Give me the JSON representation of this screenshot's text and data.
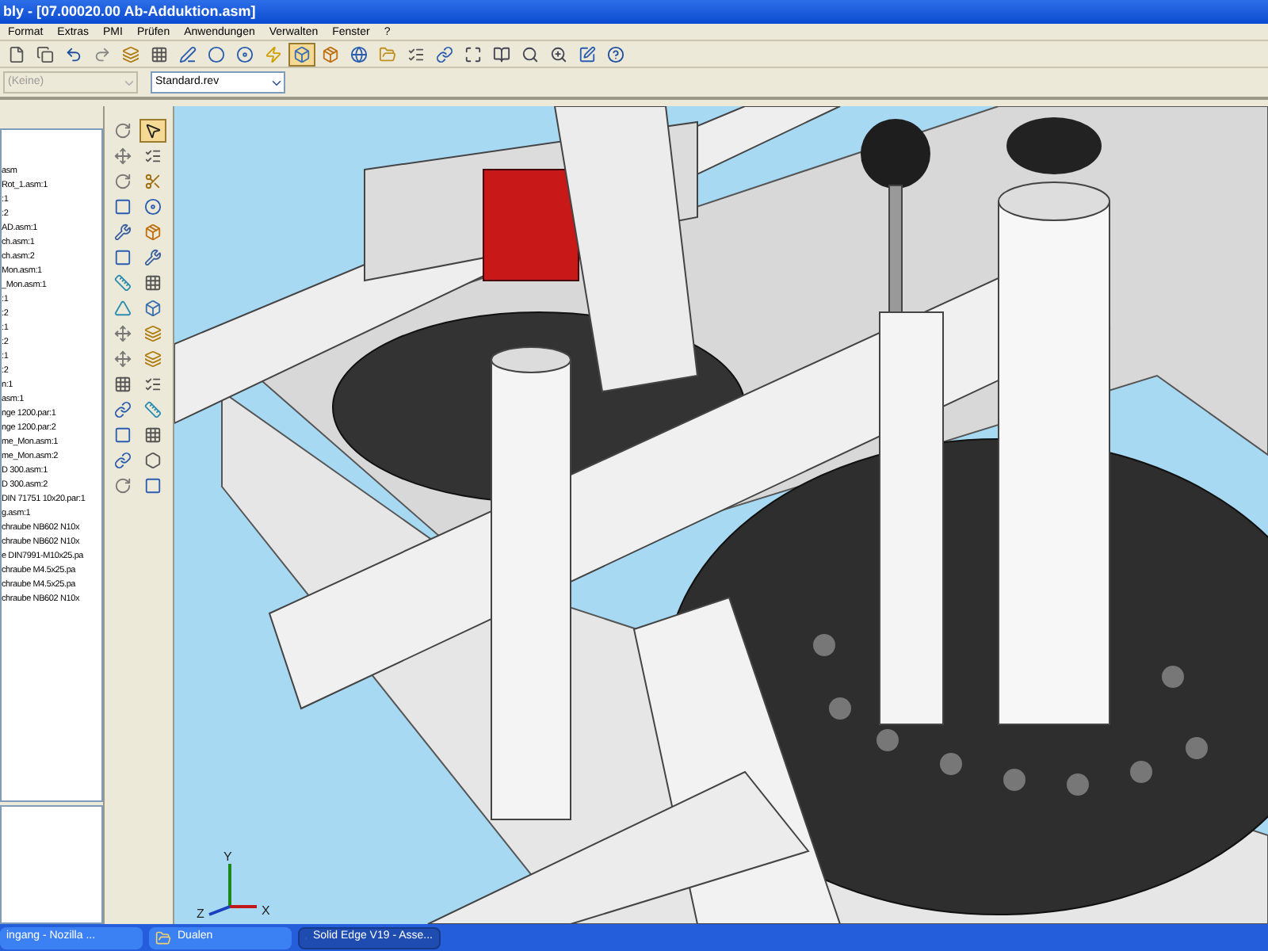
{
  "window": {
    "title": "bly - [07.00020.00 Ab-Adduktion.asm]"
  },
  "menu": [
    "Format",
    "Extras",
    "PMI",
    "Prüfen",
    "Anwendungen",
    "Verwalten",
    "Fenster",
    "?"
  ],
  "main_toolbar": [
    {
      "kind": "file",
      "selected": false
    },
    {
      "kind": "copy",
      "selected": false
    },
    {
      "kind": "undo",
      "selected": false
    },
    {
      "kind": "redo",
      "selected": false
    },
    {
      "kind": "layers",
      "selected": false
    },
    {
      "kind": "grid",
      "selected": false
    },
    {
      "kind": "pencil",
      "selected": false
    },
    {
      "kind": "circle",
      "selected": false
    },
    {
      "kind": "disc",
      "selected": false
    },
    {
      "kind": "bolt",
      "selected": false
    },
    {
      "kind": "box",
      "selected": true
    },
    {
      "kind": "cube",
      "selected": false
    },
    {
      "kind": "globe",
      "selected": false
    },
    {
      "kind": "folder",
      "selected": false
    },
    {
      "kind": "list",
      "selected": false
    },
    {
      "kind": "link",
      "selected": false
    },
    {
      "kind": "fit",
      "selected": false
    },
    {
      "kind": "book",
      "selected": false
    },
    {
      "kind": "search",
      "selected": false
    },
    {
      "kind": "zoom",
      "selected": false
    },
    {
      "kind": "edit",
      "selected": false
    },
    {
      "kind": "help",
      "selected": false
    }
  ],
  "style_toolbar": {
    "fields": [
      {
        "value": "(Keine)",
        "disabled": true
      },
      {
        "value": "Standard.rev",
        "disabled": false
      }
    ]
  },
  "tree": {
    "items": [
      "asm",
      "Rot_1.asm:1",
      ":1",
      ":2",
      "AD.asm:1",
      "ch.asm:1",
      "ch.asm:2",
      "Mon.asm:1",
      "_Mon.asm:1",
      ":1",
      ":2",
      ":1",
      ":2",
      ":1",
      ":2",
      "n:1",
      "asm:1",
      "nge 1200.par:1",
      "nge 1200.par:2",
      "me_Mon.asm:1",
      "me_Mon.asm:2",
      "D 300.asm:1",
      "D 300.asm:2",
      "DIN 71751 10x20.par:1",
      "g.asm:1",
      "chraube NB602 N10x",
      "chraube NB602 N10x",
      "e DIN7991-M10x25.pa",
      "chraube M4.5x25.pa",
      "chraube M4.5x25.pa",
      "chraube NB602 N10x"
    ]
  },
  "vertical_toolbar_left": [
    {
      "kind": "rotate",
      "selected": false
    },
    {
      "kind": "move",
      "selected": false
    },
    {
      "kind": "rotate",
      "selected": false
    },
    {
      "kind": "square",
      "selected": false
    },
    {
      "kind": "wrench",
      "selected": false
    },
    {
      "kind": "square",
      "selected": false
    },
    {
      "kind": "ruler",
      "selected": false
    },
    {
      "kind": "triangle",
      "selected": false
    },
    {
      "kind": "move",
      "selected": false
    },
    {
      "kind": "move",
      "selected": false
    },
    {
      "kind": "grid",
      "selected": false
    },
    {
      "kind": "link",
      "selected": false
    },
    {
      "kind": "square",
      "selected": false
    },
    {
      "kind": "link",
      "selected": false
    },
    {
      "kind": "rotate",
      "selected": false
    }
  ],
  "vertical_toolbar_right": [
    {
      "kind": "pointer",
      "selected": true
    },
    {
      "kind": "list",
      "selected": false
    },
    {
      "kind": "scissors",
      "selected": false
    },
    {
      "kind": "disc",
      "selected": false
    },
    {
      "kind": "cube",
      "selected": false
    },
    {
      "kind": "wrench",
      "selected": false
    },
    {
      "kind": "grid",
      "selected": false
    },
    {
      "kind": "box",
      "selected": false
    },
    {
      "kind": "layers",
      "selected": false
    },
    {
      "kind": "layers",
      "selected": false
    },
    {
      "kind": "list",
      "selected": false
    },
    {
      "kind": "ruler",
      "selected": false
    },
    {
      "kind": "grid",
      "selected": false
    },
    {
      "kind": "hexagon",
      "selected": false
    },
    {
      "kind": "square",
      "selected": false
    }
  ],
  "viewport": {
    "axes": [
      "Z",
      "Y",
      "X"
    ]
  },
  "taskbar": {
    "buttons": [
      {
        "label": "ingang - Nozilla ...",
        "kind": "browser",
        "selected": false
      },
      {
        "label": "Dualen",
        "kind": "folder",
        "selected": false
      },
      {
        "label": "Solid Edge V19 - Asse...",
        "kind": "app",
        "selected": true
      }
    ]
  }
}
